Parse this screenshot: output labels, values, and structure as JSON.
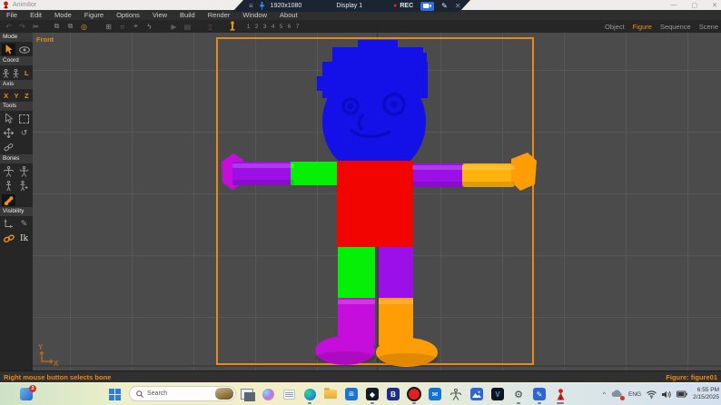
{
  "app": {
    "title": "Anim8or",
    "minimize": "—",
    "maximize": "▢",
    "close": "✕"
  },
  "recorder": {
    "resolution": "1920x1080",
    "display": "Display 1",
    "rec": "REC"
  },
  "menu": {
    "items": [
      "File",
      "Edit",
      "Mode",
      "Figure",
      "Options",
      "View",
      "Build",
      "Render",
      "Window",
      "About"
    ]
  },
  "toolbar": {
    "frames": [
      "1",
      "2",
      "3",
      "4",
      "5",
      "6",
      "7"
    ]
  },
  "tabs": {
    "object": "Object",
    "figure": "Figure",
    "sequence": "Sequence",
    "scene": "Scene"
  },
  "sidebar": {
    "mode": "Mode",
    "coord": "Coord",
    "axis": "Axis",
    "tools": "Tools",
    "bones": "Bones",
    "visibility": "Visibility",
    "x": "X",
    "y": "Y",
    "z": "Z",
    "l": "L",
    "ik": "Ik"
  },
  "viewport": {
    "view": "Front",
    "axis_x": "X",
    "axis_y": "Y"
  },
  "status": {
    "hint": "Right mouse button selects bone",
    "figure": "Figure:  figure01"
  },
  "taskbar": {
    "badge": "2",
    "search": "Search",
    "lang": "ENG",
    "time": "6:55 PM",
    "date": "2/15/2025",
    "b_label": "B",
    "v_label": "V",
    "chevron": "^"
  },
  "glyphs": {
    "hamburger": "≡",
    "rec_dot": "●",
    "undo": "↶",
    "redo": "↷",
    "cut": "✂",
    "copy": "⧉",
    "paste": "⧉",
    "target": "◎",
    "grid": "⊞",
    "ellipse": "○",
    "crosshair": "⌖",
    "lightning": "ϟ",
    "play": "▶",
    "chart": "▤",
    "capsule": "▯",
    "rotate": "↺",
    "pencil": "✎",
    "envelope": "✉",
    "gear": "⚙",
    "diamond": "◆"
  },
  "colors": {
    "accent": "#e8891d",
    "blue": "#1310e8",
    "blue_dark": "#0b0bc4",
    "red": "#f20500",
    "green": "#06ef06",
    "purple": "#9c10e8",
    "magenta": "#c50ddc",
    "orange": "#ff9d06",
    "amber": "#ffb30a"
  }
}
